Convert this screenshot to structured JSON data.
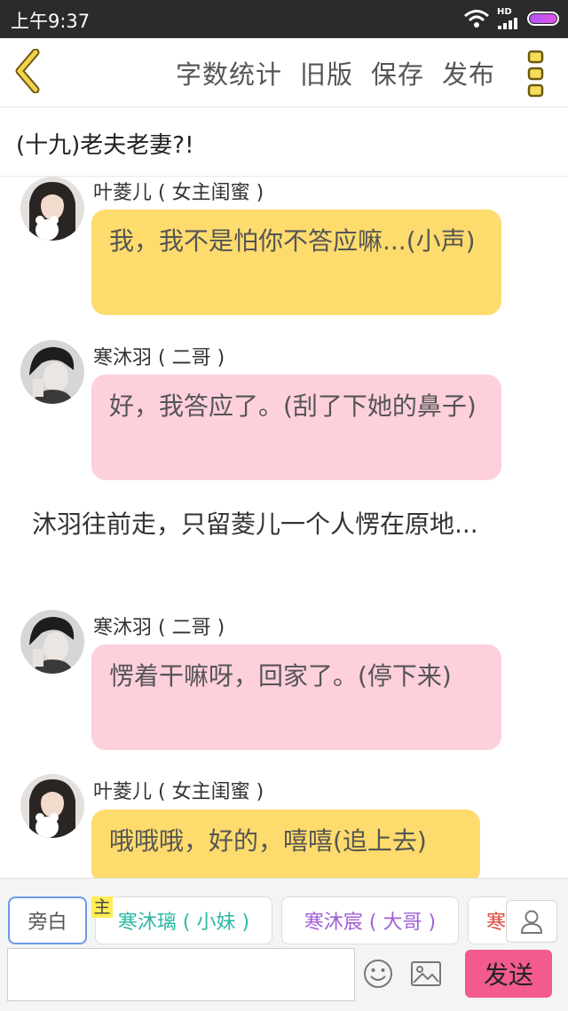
{
  "status_bar": {
    "time": "上午9:37",
    "network_label": "HD",
    "icons": [
      "wifi-icon",
      "signal-icon",
      "battery-icon"
    ]
  },
  "nav": {
    "back_icon": "chevron-left-icon",
    "actions": [
      "字数统计",
      "旧版",
      "保存",
      "发布"
    ],
    "more_icon": "more-vertical-icon"
  },
  "chapter": {
    "title": "(十九)老夫老妻?!"
  },
  "chat": {
    "messages": [
      {
        "type": "dialog",
        "speaker": "叶菱儿 ( 女主闺蜜 )",
        "text": "我，我不是怕你不答应嘛...(小声)",
        "bubble_color": "#fddb6d"
      },
      {
        "type": "dialog",
        "speaker": "寒沐羽 ( 二哥 )",
        "text": "好，我答应了。(刮了下她的鼻子)",
        "bubble_color": "#fdd0dc"
      },
      {
        "type": "narration",
        "text": "沐羽往前走，只留菱儿一个人愣在原地..."
      },
      {
        "type": "dialog",
        "speaker": "寒沐羽 ( 二哥 )",
        "text": "愣着干嘛呀，回家了。(停下来)",
        "bubble_color": "#fdd0dc"
      },
      {
        "type": "dialog",
        "speaker": "叶菱儿 ( 女主闺蜜 )",
        "text": "哦哦哦，好的，嘻嘻(追上去)",
        "bubble_color": "#fddb6d"
      }
    ]
  },
  "composer": {
    "character_tabs": [
      {
        "label": "旁白",
        "color": "#555555",
        "selected": true
      },
      {
        "label": "寒沐璃 ( 小妹 )",
        "color": "#2bb8a5",
        "selected": false
      },
      {
        "label": "寒沐宸 ( 大哥 )",
        "color": "#a15fd6",
        "selected": false
      },
      {
        "label": "寒",
        "color": "#e04a3c",
        "selected": false
      }
    ],
    "main_badge": "主",
    "input_value": "",
    "send_label": "发送",
    "icons": [
      "add-character-icon",
      "emoji-icon",
      "image-icon"
    ]
  }
}
